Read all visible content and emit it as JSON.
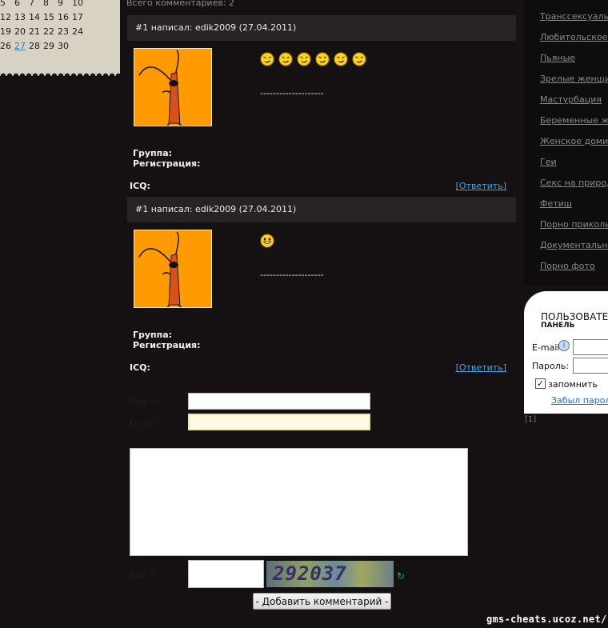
{
  "calendar": {
    "rows": [
      [
        "5",
        "6",
        "7",
        "8",
        "9",
        "10"
      ],
      [
        "12",
        "13",
        "14",
        "15",
        "16",
        "17"
      ],
      [
        "19",
        "20",
        "21",
        "22",
        "23",
        "24"
      ],
      [
        "26",
        "27",
        "28",
        "29",
        "30",
        ""
      ]
    ],
    "today": "27"
  },
  "comments_total": "Всего комментариев: 2",
  "comments": [
    {
      "header": "#1 написал: edik2009 (27.04.2011)",
      "smiley_count": 6,
      "dashes": "--------------------",
      "group_label": "Группа:",
      "registration_label": "Регистрация:",
      "icq_label": "ICQ:",
      "reply_label": "[Ответить]"
    },
    {
      "header": "#1 написал: edik2009 (27.04.2011)",
      "smiley_count": 1,
      "dashes": "--------------------",
      "group_label": "Группа:",
      "registration_label": "Регистрация:",
      "icq_label": "ICQ:",
      "reply_label": "[Ответить]"
    }
  ],
  "form": {
    "name_label": "Имя *:",
    "email_label": "Email:",
    "code_label": "Код *:",
    "captcha_text": "292037",
    "submit_label": "- Добавить комментарий -"
  },
  "categories": [
    "Транссексуалы",
    "Любительское порно",
    "Пьяные",
    "Зрелые женщины",
    "Мастурбация",
    "Беременные женщины",
    "Женское доминирование",
    "Геи",
    "Секс на природе",
    "Фетиш",
    "Порно приколы",
    "Документальное",
    "Порно фото"
  ],
  "login_panel": {
    "title": "ПОЛЬЗОВАТЕЛЬСКАЯ",
    "subtitle": "ПАНЕЛЬ",
    "email_label": "E-mail:",
    "password_label": "Пароль:",
    "remember_label": "запомнить",
    "forgot_label": "Забыл пароль"
  },
  "counter_text": "[1]",
  "footer_url": "gms-cheats.ucoz.net/"
}
